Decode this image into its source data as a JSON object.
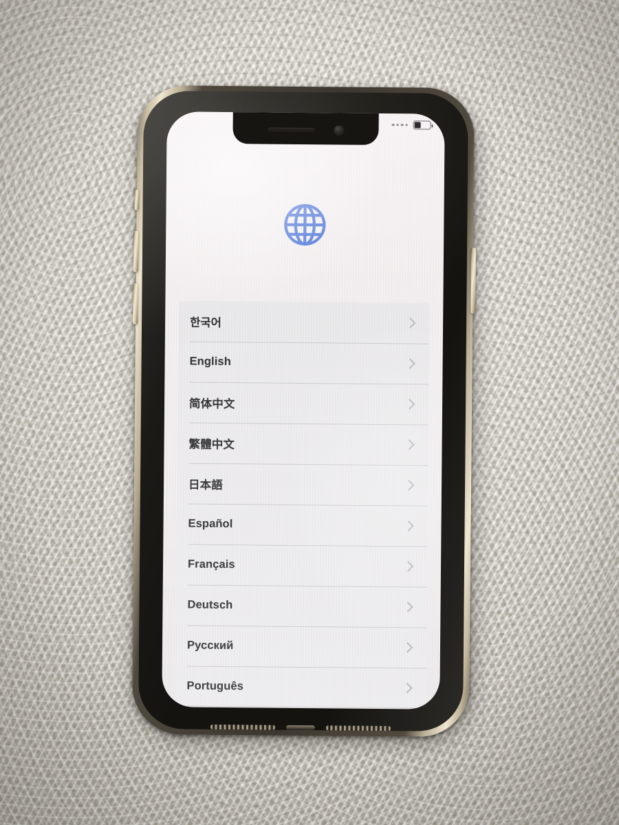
{
  "device": {
    "kind": "smartphone",
    "frame_color": "#c9bda2",
    "body_color": "#1a1916",
    "screen_background": "#f3eff0"
  },
  "status_bar": {
    "signal_dots": 4,
    "battery_level_percent": 40,
    "battery_fill_color": "#2c2c2e",
    "battery_outline_color": "#6e6e72"
  },
  "header": {
    "icon_name": "globe-icon",
    "icon_color": "#2f5fd4",
    "icon_alt": "Globe"
  },
  "language_list": {
    "chevron_color": "#b4b4b8",
    "divider_color": "#aaaaae",
    "items": [
      {
        "label": "한국어",
        "chevron": "chevron-right-icon"
      },
      {
        "label": "English",
        "chevron": "chevron-right-icon"
      },
      {
        "label": "简体中文",
        "chevron": "chevron-right-icon"
      },
      {
        "label": "繁體中文",
        "chevron": "chevron-right-icon"
      },
      {
        "label": "日本語",
        "chevron": "chevron-right-icon"
      },
      {
        "label": "Español",
        "chevron": "chevron-right-icon"
      },
      {
        "label": "Français",
        "chevron": "chevron-right-icon"
      },
      {
        "label": "Deutsch",
        "chevron": "chevron-right-icon"
      },
      {
        "label": "Русский",
        "chevron": "chevron-right-icon"
      },
      {
        "label": "Português",
        "chevron": "chevron-right-icon"
      }
    ]
  },
  "hardware": {
    "mute_switch": "mute-switch",
    "volume_up": "volume-up-button",
    "volume_down": "volume-down-button",
    "power": "power-button",
    "speaker": "speaker-grill",
    "port": "lightning-port"
  }
}
